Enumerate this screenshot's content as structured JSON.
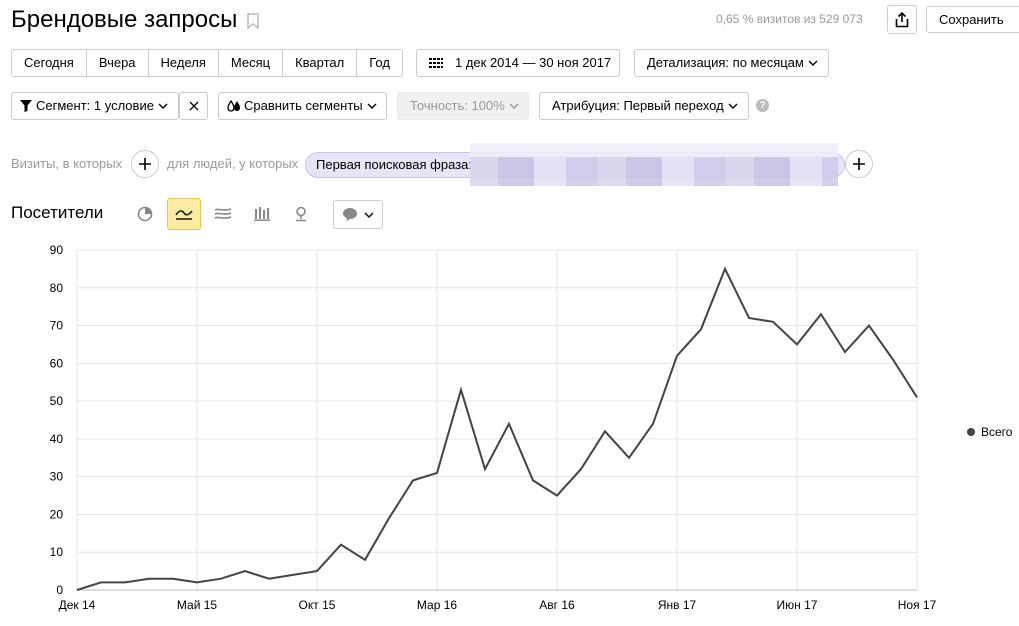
{
  "header": {
    "title": "Брендовые запросы",
    "visits_info": "0,65 % визитов из 529 073",
    "save_label": "Сохранить"
  },
  "periods": [
    "Сегодня",
    "Вчера",
    "Неделя",
    "Месяц",
    "Квартал",
    "Год"
  ],
  "date_range": "1 дек 2014 — 30 ноя 2017",
  "detail": "Детализация: по месяцам",
  "filters": {
    "segment": "Сегмент: 1 условие",
    "compare": "Сравнить сегменты",
    "accuracy": "Точность: 100%",
    "attribution": "Атрибуция: Первый переход",
    "help": "?"
  },
  "segment_builder": {
    "visits_label": "Визиты, в которых",
    "people_label": "для людей, у которых",
    "condition": "Первая поисковая фраза:"
  },
  "section_title": "Посетители",
  "colors": {
    "accent": "#fdeba3",
    "line": "#444444",
    "grid": "#e5e5e5",
    "chip": "#e6e4f6"
  },
  "chart_data": {
    "type": "line",
    "title": "",
    "xlabel": "",
    "ylabel": "",
    "ylim": [
      0,
      90
    ],
    "yticks": [
      0,
      10,
      20,
      30,
      40,
      50,
      60,
      70,
      80,
      90
    ],
    "xticks": [
      {
        "label": "Дек 14",
        "index": 0
      },
      {
        "label": "Май 15",
        "index": 5
      },
      {
        "label": "Окт 15",
        "index": 10
      },
      {
        "label": "Мар 16",
        "index": 15
      },
      {
        "label": "Авг 16",
        "index": 20
      },
      {
        "label": "Янв 17",
        "index": 25
      },
      {
        "label": "Июн 17",
        "index": 30
      },
      {
        "label": "Ноя 17",
        "index": 35
      }
    ],
    "grid": true,
    "legend_position": "right",
    "series": [
      {
        "name": "Всего",
        "values": [
          0,
          2,
          2,
          3,
          3,
          2,
          3,
          5,
          3,
          4,
          5,
          12,
          8,
          19,
          29,
          31,
          53,
          32,
          44,
          29,
          25,
          32,
          42,
          35,
          44,
          62,
          69,
          85,
          72,
          71,
          65,
          73,
          63,
          70,
          61,
          51
        ]
      }
    ]
  }
}
